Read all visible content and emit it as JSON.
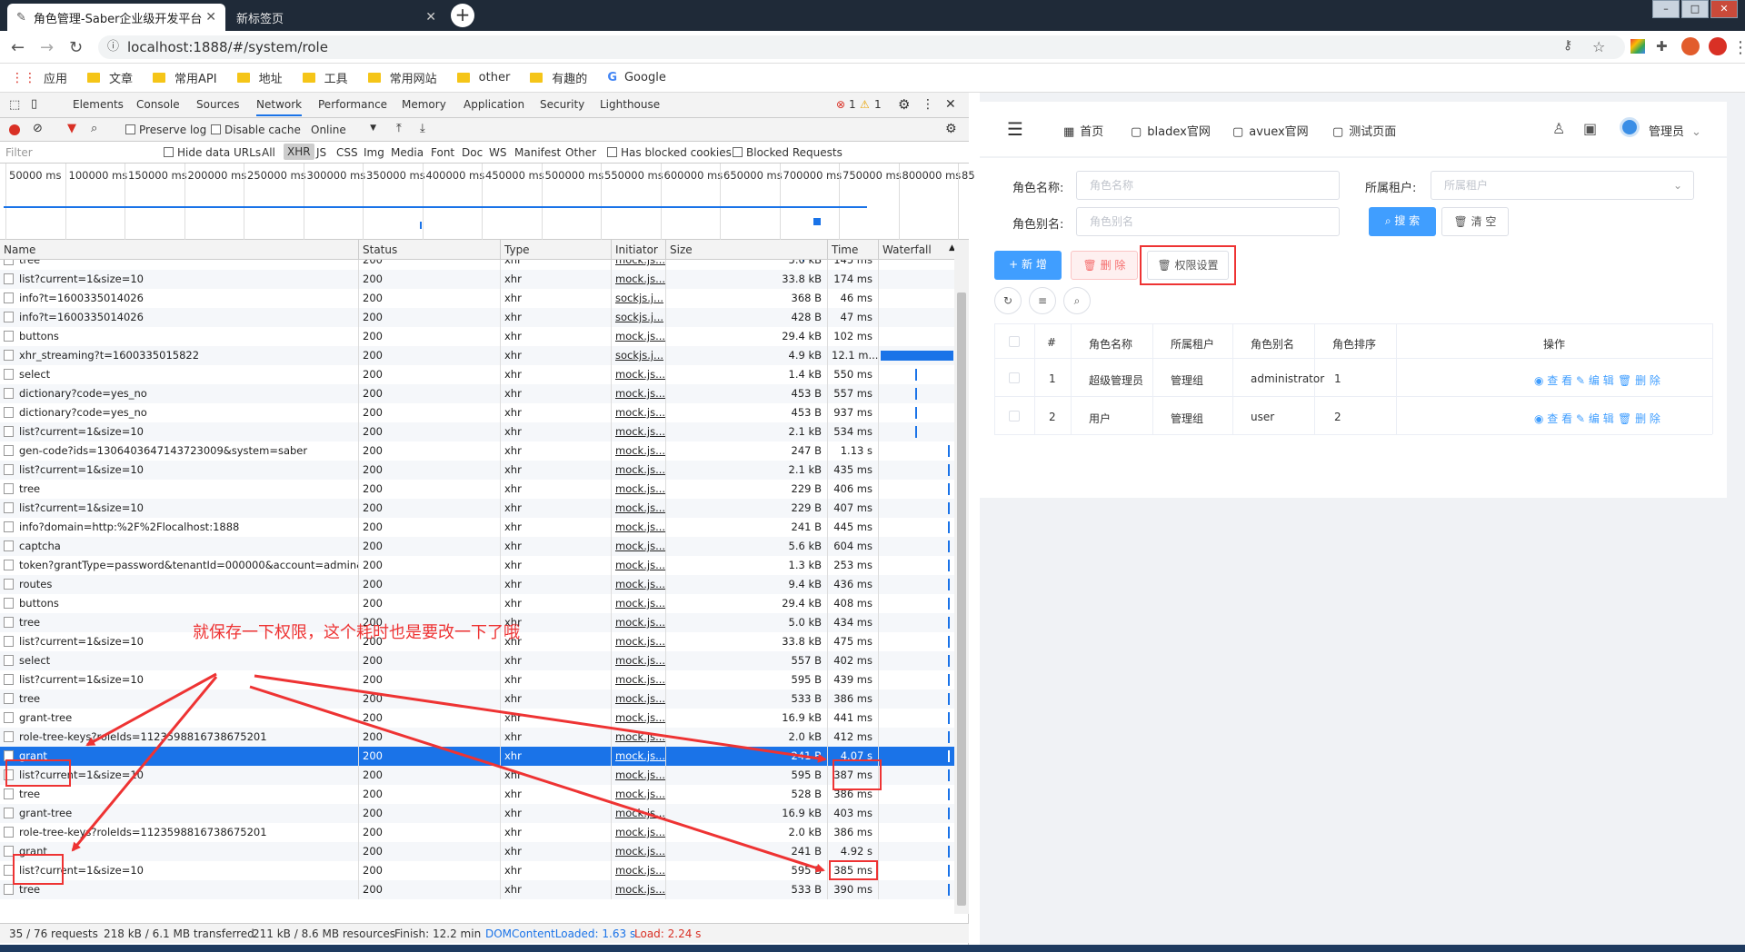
{
  "browser": {
    "tabs": [
      {
        "title": "角色管理-Saber企业级开发平台",
        "active": true
      },
      {
        "title": "新标签页",
        "active": false
      }
    ],
    "url": "localhost:1888/#/system/role",
    "bookmarks": [
      "应用",
      "文章",
      "常用API",
      "地址",
      "工具",
      "常用网站",
      "other",
      "有趣的",
      "Google"
    ]
  },
  "devtools": {
    "tabs": [
      "Elements",
      "Console",
      "Sources",
      "Network",
      "Performance",
      "Memory",
      "Application",
      "Security",
      "Lighthouse"
    ],
    "selected_tab": "Network",
    "errors": "1",
    "warnings": "1",
    "toolbar": {
      "preserve_log": "Preserve log",
      "disable_cache": "Disable cache",
      "throttle": "Online"
    },
    "filter": {
      "placeholder": "Filter",
      "hide_data_urls": "Hide data URLs",
      "types": [
        "All",
        "XHR",
        "JS",
        "CSS",
        "Img",
        "Media",
        "Font",
        "Doc",
        "WS",
        "Manifest",
        "Other"
      ],
      "selected_type": "XHR",
      "blocked_cookies": "Has blocked cookies",
      "blocked_requests": "Blocked Requests"
    },
    "overview_ticks": [
      "50000 ms",
      "100000 ms",
      "150000 ms",
      "200000 ms",
      "250000 ms",
      "300000 ms",
      "350000 ms",
      "400000 ms",
      "450000 ms",
      "500000 ms",
      "550000 ms",
      "600000 ms",
      "650000 ms",
      "700000 ms",
      "750000 ms",
      "800000 ms",
      "85"
    ],
    "columns": [
      "Name",
      "Status",
      "Type",
      "Initiator",
      "Size",
      "Time",
      "Waterfall"
    ],
    "rows": [
      {
        "name": "tree",
        "status": "200",
        "type": "xhr",
        "initiator": "mock.js...",
        "size": "5.0 kB",
        "time": "145 ms"
      },
      {
        "name": "list?current=1&size=10",
        "status": "200",
        "type": "xhr",
        "initiator": "mock.js...",
        "size": "33.8 kB",
        "time": "174 ms"
      },
      {
        "name": "info?t=1600335014026",
        "status": "200",
        "type": "xhr",
        "initiator": "sockjs.j...",
        "size": "368 B",
        "time": "46 ms"
      },
      {
        "name": "info?t=1600335014026",
        "status": "200",
        "type": "xhr",
        "initiator": "sockjs.j...",
        "size": "428 B",
        "time": "47 ms"
      },
      {
        "name": "buttons",
        "status": "200",
        "type": "xhr",
        "initiator": "mock.js...",
        "size": "29.4 kB",
        "time": "102 ms"
      },
      {
        "name": "xhr_streaming?t=1600335015822",
        "status": "200",
        "type": "xhr",
        "initiator": "sockjs.j...",
        "size": "4.9 kB",
        "time": "12.1 m..."
      },
      {
        "name": "select",
        "status": "200",
        "type": "xhr",
        "initiator": "mock.js...",
        "size": "1.4 kB",
        "time": "550 ms"
      },
      {
        "name": "dictionary?code=yes_no",
        "status": "200",
        "type": "xhr",
        "initiator": "mock.js...",
        "size": "453 B",
        "time": "557 ms"
      },
      {
        "name": "dictionary?code=yes_no",
        "status": "200",
        "type": "xhr",
        "initiator": "mock.js...",
        "size": "453 B",
        "time": "937 ms"
      },
      {
        "name": "list?current=1&size=10",
        "status": "200",
        "type": "xhr",
        "initiator": "mock.js...",
        "size": "2.1 kB",
        "time": "534 ms"
      },
      {
        "name": "gen-code?ids=1306403647143723009&system=saber",
        "status": "200",
        "type": "xhr",
        "initiator": "mock.js...",
        "size": "247 B",
        "time": "1.13 s"
      },
      {
        "name": "list?current=1&size=10",
        "status": "200",
        "type": "xhr",
        "initiator": "mock.js...",
        "size": "2.1 kB",
        "time": "435 ms"
      },
      {
        "name": "tree",
        "status": "200",
        "type": "xhr",
        "initiator": "mock.js...",
        "size": "229 B",
        "time": "406 ms"
      },
      {
        "name": "list?current=1&size=10",
        "status": "200",
        "type": "xhr",
        "initiator": "mock.js...",
        "size": "229 B",
        "time": "407 ms"
      },
      {
        "name": "info?domain=http:%2F%2Flocalhost:1888",
        "status": "200",
        "type": "xhr",
        "initiator": "mock.js...",
        "size": "241 B",
        "time": "445 ms"
      },
      {
        "name": "captcha",
        "status": "200",
        "type": "xhr",
        "initiator": "mock.js...",
        "size": "5.6 kB",
        "time": "604 ms"
      },
      {
        "name": "token?grantType=password&tenantId=000000&account=admin&...",
        "status": "200",
        "type": "xhr",
        "initiator": "mock.js...",
        "size": "1.3 kB",
        "time": "253 ms"
      },
      {
        "name": "routes",
        "status": "200",
        "type": "xhr",
        "initiator": "mock.js...",
        "size": "9.4 kB",
        "time": "436 ms"
      },
      {
        "name": "buttons",
        "status": "200",
        "type": "xhr",
        "initiator": "mock.js...",
        "size": "29.4 kB",
        "time": "408 ms"
      },
      {
        "name": "tree",
        "status": "200",
        "type": "xhr",
        "initiator": "mock.js...",
        "size": "5.0 kB",
        "time": "434 ms"
      },
      {
        "name": "list?current=1&size=10",
        "status": "200",
        "type": "xhr",
        "initiator": "mock.js...",
        "size": "33.8 kB",
        "time": "475 ms"
      },
      {
        "name": "select",
        "status": "200",
        "type": "xhr",
        "initiator": "mock.js...",
        "size": "557 B",
        "time": "402 ms"
      },
      {
        "name": "list?current=1&size=10",
        "status": "200",
        "type": "xhr",
        "initiator": "mock.js...",
        "size": "595 B",
        "time": "439 ms"
      },
      {
        "name": "tree",
        "status": "200",
        "type": "xhr",
        "initiator": "mock.js...",
        "size": "533 B",
        "time": "386 ms"
      },
      {
        "name": "grant-tree",
        "status": "200",
        "type": "xhr",
        "initiator": "mock.js...",
        "size": "16.9 kB",
        "time": "441 ms"
      },
      {
        "name": "role-tree-keys?roleIds=1123598816738675201",
        "status": "200",
        "type": "xhr",
        "initiator": "mock.js...",
        "size": "2.0 kB",
        "time": "412 ms"
      },
      {
        "name": "grant",
        "status": "200",
        "type": "xhr",
        "initiator": "mock.js...",
        "size": "241 B",
        "time": "4.07 s",
        "selected": true
      },
      {
        "name": "list?current=1&size=10",
        "status": "200",
        "type": "xhr",
        "initiator": "mock.js...",
        "size": "595 B",
        "time": "387 ms"
      },
      {
        "name": "tree",
        "status": "200",
        "type": "xhr",
        "initiator": "mock.js...",
        "size": "528 B",
        "time": "386 ms"
      },
      {
        "name": "grant-tree",
        "status": "200",
        "type": "xhr",
        "initiator": "mock.js...",
        "size": "16.9 kB",
        "time": "403 ms"
      },
      {
        "name": "role-tree-keys?roleIds=1123598816738675201",
        "status": "200",
        "type": "xhr",
        "initiator": "mock.js...",
        "size": "2.0 kB",
        "time": "386 ms"
      },
      {
        "name": "grant",
        "status": "200",
        "type": "xhr",
        "initiator": "mock.js...",
        "size": "241 B",
        "time": "4.92 s"
      },
      {
        "name": "list?current=1&size=10",
        "status": "200",
        "type": "xhr",
        "initiator": "mock.js...",
        "size": "595 B",
        "time": "385 ms"
      },
      {
        "name": "tree",
        "status": "200",
        "type": "xhr",
        "initiator": "mock.js...",
        "size": "533 B",
        "time": "390 ms"
      }
    ],
    "status": {
      "requests": "35 / 76 requests",
      "transferred": "218 kB / 6.1 MB transferred",
      "resources": "211 kB / 8.6 MB resources",
      "finish": "Finish: 12.2 min",
      "dcl": "DOMContentLoaded: 1.63 s",
      "load": "Load: 2.24 s"
    },
    "colors": {
      "dcl": "#1a73e8",
      "load": "#d93025",
      "selected_row": "#1a73e8"
    }
  },
  "annotation": {
    "text": "就保存一下权限，这个耗时也是要改一下了哦",
    "color": "#e33333"
  },
  "app": {
    "header": {
      "nav": [
        "首页",
        "bladex官网",
        "avuex官网",
        "测试页面"
      ],
      "user": "管理员"
    },
    "search": {
      "role_name_label": "角色名称:",
      "role_name_placeholder": "角色名称",
      "tenant_label": "所属租户:",
      "tenant_placeholder": "所属租户",
      "alias_label": "角色别名:",
      "alias_placeholder": "角色别名",
      "search_btn": "搜 索",
      "clear_btn": "清 空"
    },
    "actions": {
      "add": "新 增",
      "delete": "删 除",
      "permission": "权限设置"
    },
    "table": {
      "headers": [
        "#",
        "角色名称",
        "所属租户",
        "角色别名",
        "角色排序",
        "操作"
      ],
      "rows": [
        {
          "index": "1",
          "name": "超级管理员",
          "tenant": "管理组",
          "alias": "administrator",
          "sort": "1"
        },
        {
          "index": "2",
          "name": "用户",
          "tenant": "管理组",
          "alias": "user",
          "sort": "2"
        }
      ],
      "ops": {
        "view": "查 看",
        "edit": "编 辑",
        "delete": "删 除"
      }
    },
    "colors": {
      "primary": "#409eff",
      "danger": "#f56c6c"
    }
  }
}
